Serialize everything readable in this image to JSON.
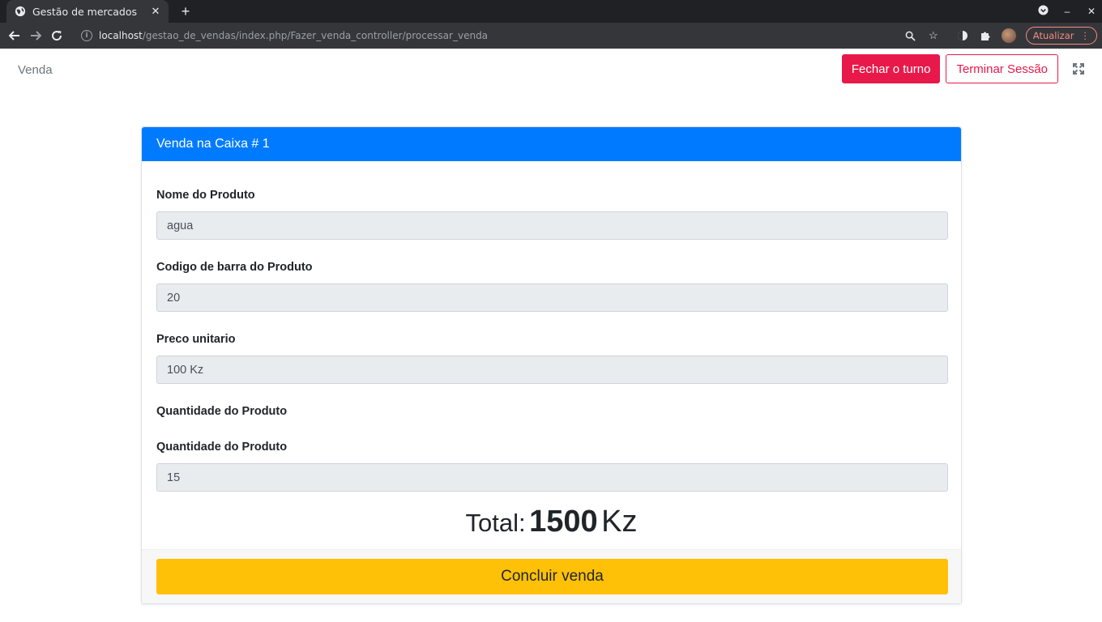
{
  "browser": {
    "tab_title": "Gestão de mercados",
    "url_host": "localhost",
    "url_path": "/gestao_de_vendas/index.php/Fazer_venda_controller/processar_venda",
    "update_label": "Atualizar",
    "accent": "#f28b82"
  },
  "nav": {
    "brand": "Venda",
    "close_shift_label": "Fechar o turno",
    "logout_label": "Terminar Sessão"
  },
  "card": {
    "header": "Venda na Caixa # 1",
    "fields": {
      "product_name": {
        "label": "Nome do Produto",
        "value": "agua"
      },
      "barcode": {
        "label": "Codigo de barra do Produto",
        "value": "20"
      },
      "unit_price": {
        "label": "Preco unitario",
        "value": "100 Kz"
      },
      "quantity_heading": "Quantidade do Produto",
      "quantity": {
        "label": "Quantidade do Produto",
        "value": "15"
      }
    },
    "total": {
      "label": "Total:",
      "value": "1500",
      "unit": "Kz"
    },
    "submit_label": "Concluir venda"
  },
  "colors": {
    "primary": "#007bff",
    "danger": "#e8194a",
    "warning": "#ffc107"
  }
}
